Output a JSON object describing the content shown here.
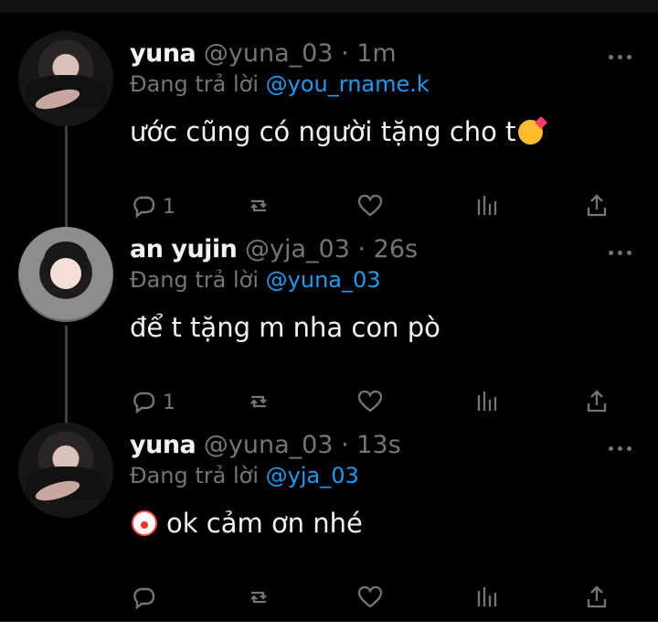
{
  "tweets": [
    {
      "name": "yuna",
      "handle": "@yuna_03",
      "separator": "·",
      "time": "1m",
      "reply_prefix": "Đang trả lời",
      "reply_to": "@you_rname.k",
      "text": "ước cũng có người tặng cho t",
      "emoji": "smiling-face-with-hearts",
      "reply_count": "1"
    },
    {
      "name": "an yujin",
      "handle": "@yja_03",
      "separator": "·",
      "time": "26s",
      "reply_prefix": "Đang trả lời",
      "reply_to": "@yuna_03",
      "text": "để t tặng m nha con pò",
      "emoji": "",
      "reply_count": "1"
    },
    {
      "name": "yuna",
      "handle": "@yuna_03",
      "separator": "·",
      "time": "13s",
      "reply_prefix": "Đang trả lời",
      "reply_to": "@yja_03",
      "text": "ok cảm ơn nhé",
      "emoji": "clown-face",
      "reply_count": ""
    }
  ],
  "colors": {
    "background": "#000000",
    "text": "#e7e9ea",
    "muted": "#71767b",
    "link": "#1d9bf0",
    "thread_line": "#3e4144"
  }
}
